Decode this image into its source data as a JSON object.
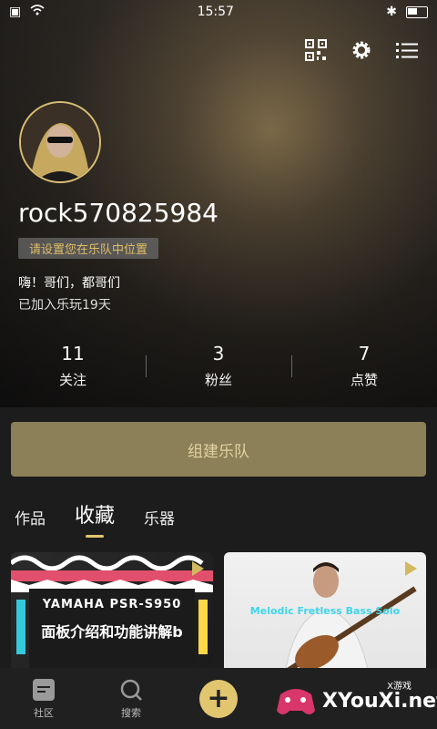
{
  "status_bar": {
    "time": "15:57"
  },
  "profile": {
    "username": "rock570825984",
    "role_prompt": "请设置您在乐队中位置",
    "bio": "嗨！哥们，都哥们",
    "joined": "已加入乐玩19天"
  },
  "stats": [
    {
      "value": "11",
      "label": "关注"
    },
    {
      "value": "3",
      "label": "粉丝"
    },
    {
      "value": "7",
      "label": "点赞"
    }
  ],
  "actions": {
    "create_band": "组建乐队"
  },
  "tabs": [
    {
      "label": "作品"
    },
    {
      "label": "收藏",
      "active": true
    },
    {
      "label": "乐器"
    }
  ],
  "cards": [
    {
      "line1": "YAMAHA PSR-S950",
      "line2": "面板介绍和功能讲解b"
    },
    {
      "line1": "Melodic Fretless Bass Solo"
    }
  ],
  "bottom_nav": [
    {
      "label": "社区"
    },
    {
      "label": "搜索"
    },
    {
      "label": ""
    }
  ],
  "watermark": {
    "main": "XYouXi.net",
    "sub": "X游戏"
  }
}
